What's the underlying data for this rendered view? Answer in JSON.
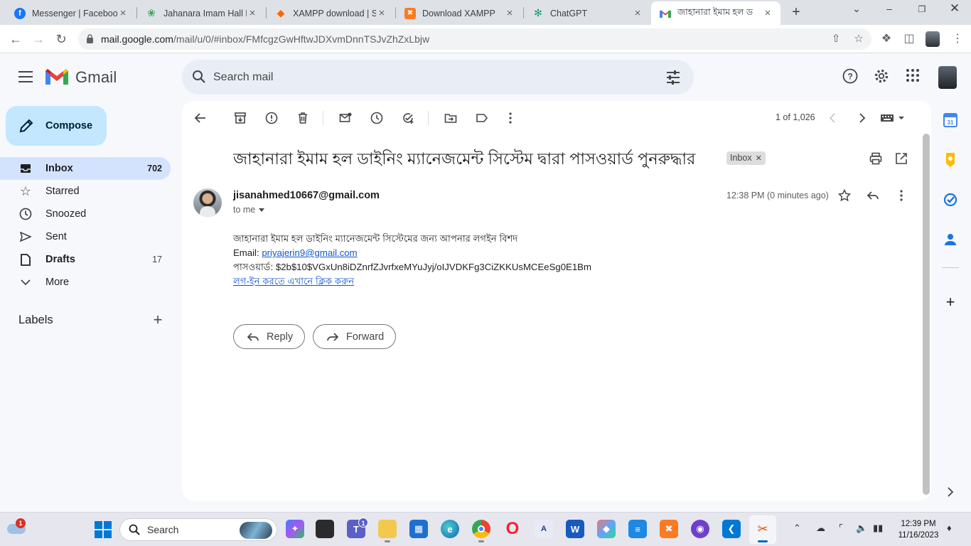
{
  "browser": {
    "tabs": [
      {
        "title": "Messenger | Facebook",
        "icon": "facebook-icon",
        "color": "#1877f2",
        "active": false
      },
      {
        "title": "Jahanara Imam Hall D",
        "icon": "leaf-icon",
        "color": "#34a853",
        "active": false
      },
      {
        "title": "XAMPP download | S",
        "icon": "sourceforge-icon",
        "color": "#ff6600",
        "active": false
      },
      {
        "title": "Download XAMPP",
        "icon": "xampp-icon",
        "color": "#fb7a24",
        "active": false
      },
      {
        "title": "ChatGPT",
        "icon": "chatgpt-icon",
        "color": "#10a37f",
        "active": false
      },
      {
        "title": "জাহানারা ইমাম হল ড",
        "icon": "gmail-icon",
        "color": "#ea4335",
        "active": true
      }
    ],
    "url_host": "mail.google.com",
    "url_path": "/mail/u/0/#inbox/FMfcgzGwHftwJDXvmDnnTSJvZhZxLbjw"
  },
  "gmail": {
    "logo_text": "Gmail",
    "search_placeholder": "Search mail",
    "compose_label": "Compose",
    "nav": [
      {
        "label": "Inbox",
        "count": "702",
        "icon": "inbox-icon",
        "active": true,
        "bold": true
      },
      {
        "label": "Starred",
        "count": "",
        "icon": "star-icon",
        "active": false,
        "bold": false
      },
      {
        "label": "Snoozed",
        "count": "",
        "icon": "clock-icon",
        "active": false,
        "bold": false
      },
      {
        "label": "Sent",
        "count": "",
        "icon": "send-icon",
        "active": false,
        "bold": false
      },
      {
        "label": "Drafts",
        "count": "17",
        "icon": "draft-icon",
        "active": false,
        "bold": true
      },
      {
        "label": "More",
        "count": "",
        "icon": "chevron-down-icon",
        "active": false,
        "bold": false
      }
    ],
    "labels_heading": "Labels",
    "pager": "1 of 1,026"
  },
  "email": {
    "subject": "জাহানারা ইমাম হল ডাইনিং ম্যানেজমেন্ট সিস্টেম দ্বারা পাসওয়ার্ড পুনরুদ্ধার",
    "label_chip": "Inbox",
    "sender": "jisanahmed10667@gmail.com",
    "to": "to me",
    "time": "12:38 PM (0 minutes ago)",
    "body_line1": "জাহানারা ইমাম হল ডাইনিং ম্যানেজমেন্ট সিস্টেমের জন্য আপনার লগইন বিশদ",
    "email_label": "Email: ",
    "email_value": "priyajerin9@gmail.com",
    "password_label": "পাসওয়ার্ড: ",
    "password_value": "$2b$10$VGxUn8iDZnrfZJvrfxeMYuJyj/oIJVDKFg3CiZKKUsMCEeSg0E1Bm",
    "login_link": "লগ-ইন করতে এখানে ক্লিক করুন",
    "reply_label": "Reply",
    "forward_label": "Forward"
  },
  "taskbar": {
    "search_label": "Search",
    "time": "12:39 PM",
    "date": "11/16/2023",
    "weather_badge": "1",
    "teams_badge": "1"
  },
  "colors": {
    "accent": "#0b57d0",
    "compose_bg": "#c2e7ff",
    "active_nav_bg": "#d3e3fd",
    "link": "#1155cc"
  }
}
